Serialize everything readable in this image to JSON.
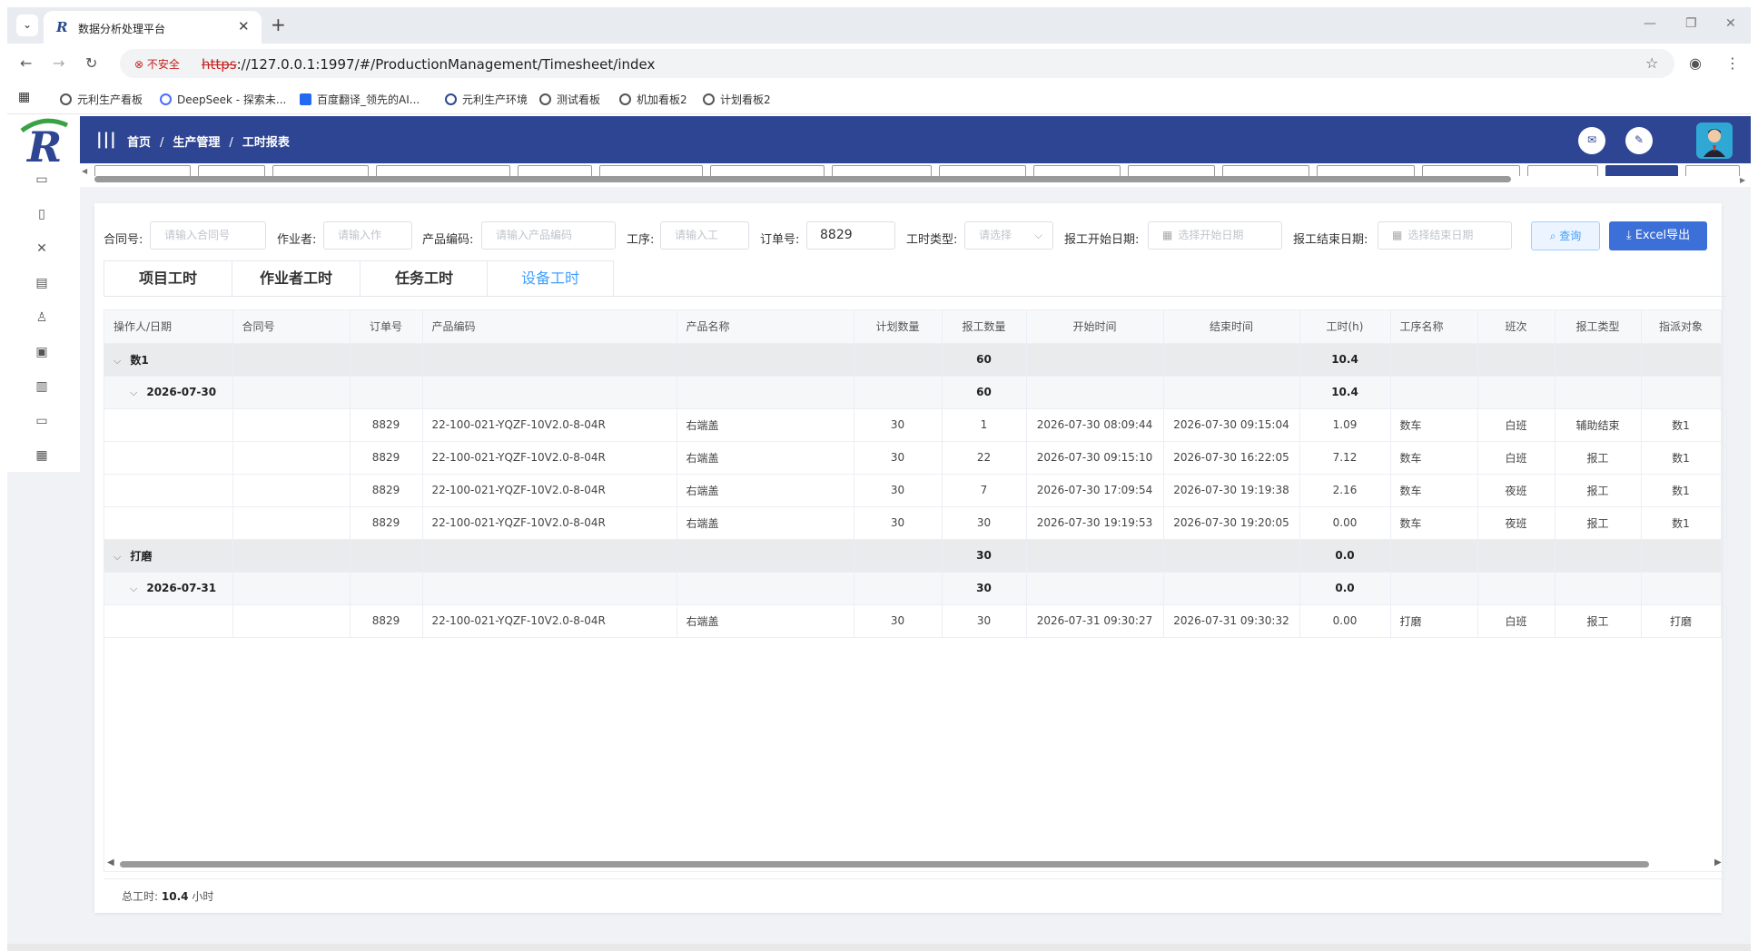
{
  "browser": {
    "tab_title": "数据分析处理平台",
    "insecure_label": "不安全",
    "url_scheme": "https",
    "url_rest": "://127.0.0.1:1997/#/ProductionManagement/Timesheet/index",
    "bookmarks": [
      "元利生产看板",
      "DeepSeek - 探索未...",
      "百度翻译_领先的AI...",
      "元利生产环境",
      "测试看板",
      "机加看板2",
      "计划看板2"
    ]
  },
  "header": {
    "breadcrumb": [
      "首页",
      "生产管理",
      "工时报表"
    ]
  },
  "filters": {
    "contract_label": "合同号:",
    "contract_placeholder": "请输入合同号",
    "worker_label": "作业者:",
    "worker_placeholder": "请输入作",
    "product_label": "产品编码:",
    "product_placeholder": "请输入产品编码",
    "process_label": "工序:",
    "process_placeholder": "请输入工",
    "order_label": "订单号:",
    "order_value": "8829",
    "type_label": "工时类型:",
    "type_placeholder": "请选择",
    "start_label": "报工开始日期:",
    "start_placeholder": "选择开始日期",
    "end_label": "报工结束日期:",
    "end_placeholder": "选择结束日期",
    "query_button": "查询",
    "export_button": "Excel导出"
  },
  "subtabs": [
    "项目工时",
    "作业者工时",
    "任务工时",
    "设备工时"
  ],
  "table": {
    "columns": [
      "操作人/日期",
      "合同号",
      "订单号",
      "产品编码",
      "产品名称",
      "计划数量",
      "报工数量",
      "开始时间",
      "结束时间",
      "工时(h)",
      "工序名称",
      "班次",
      "报工类型",
      "指派对象"
    ],
    "groups": [
      {
        "name": "数1",
        "qty": "60",
        "hours": "10.4",
        "dates": [
          {
            "date": "2026-07-30",
            "qty": "60",
            "hours": "10.4",
            "rows": [
              {
                "order": "8829",
                "code": "22-100-021-YQZF-10V2.0-8-04R",
                "name": "右端盖",
                "plan": "30",
                "qty": "1",
                "start": "2026-07-30 08:09:44",
                "end": "2026-07-30 09:15:04",
                "hours": "1.09",
                "process": "数车",
                "shift": "白班",
                "type": "辅助结束",
                "assignee": "数1"
              },
              {
                "order": "8829",
                "code": "22-100-021-YQZF-10V2.0-8-04R",
                "name": "右端盖",
                "plan": "30",
                "qty": "22",
                "start": "2026-07-30 09:15:10",
                "end": "2026-07-30 16:22:05",
                "hours": "7.12",
                "process": "数车",
                "shift": "白班",
                "type": "报工",
                "assignee": "数1"
              },
              {
                "order": "8829",
                "code": "22-100-021-YQZF-10V2.0-8-04R",
                "name": "右端盖",
                "plan": "30",
                "qty": "7",
                "start": "2026-07-30 17:09:54",
                "end": "2026-07-30 19:19:38",
                "hours": "2.16",
                "process": "数车",
                "shift": "夜班",
                "type": "报工",
                "assignee": "数1"
              },
              {
                "order": "8829",
                "code": "22-100-021-YQZF-10V2.0-8-04R",
                "name": "右端盖",
                "plan": "30",
                "qty": "30",
                "start": "2026-07-30 19:19:53",
                "end": "2026-07-30 19:20:05",
                "hours": "0.00",
                "process": "数车",
                "shift": "夜班",
                "type": "报工",
                "assignee": "数1"
              }
            ]
          }
        ]
      },
      {
        "name": "打磨",
        "qty": "30",
        "hours": "0.0",
        "dates": [
          {
            "date": "2026-07-31",
            "qty": "30",
            "hours": "0.0",
            "rows": [
              {
                "order": "8829",
                "code": "22-100-021-YQZF-10V2.0-8-04R",
                "name": "右端盖",
                "plan": "30",
                "qty": "30",
                "start": "2026-07-31 09:30:27",
                "end": "2026-07-31 09:30:32",
                "hours": "0.00",
                "process": "打磨",
                "shift": "白班",
                "type": "报工",
                "assignee": "打磨"
              }
            ]
          }
        ]
      }
    ]
  },
  "summary": {
    "label": "总工时:",
    "value": "10.4",
    "unit": "小时"
  }
}
